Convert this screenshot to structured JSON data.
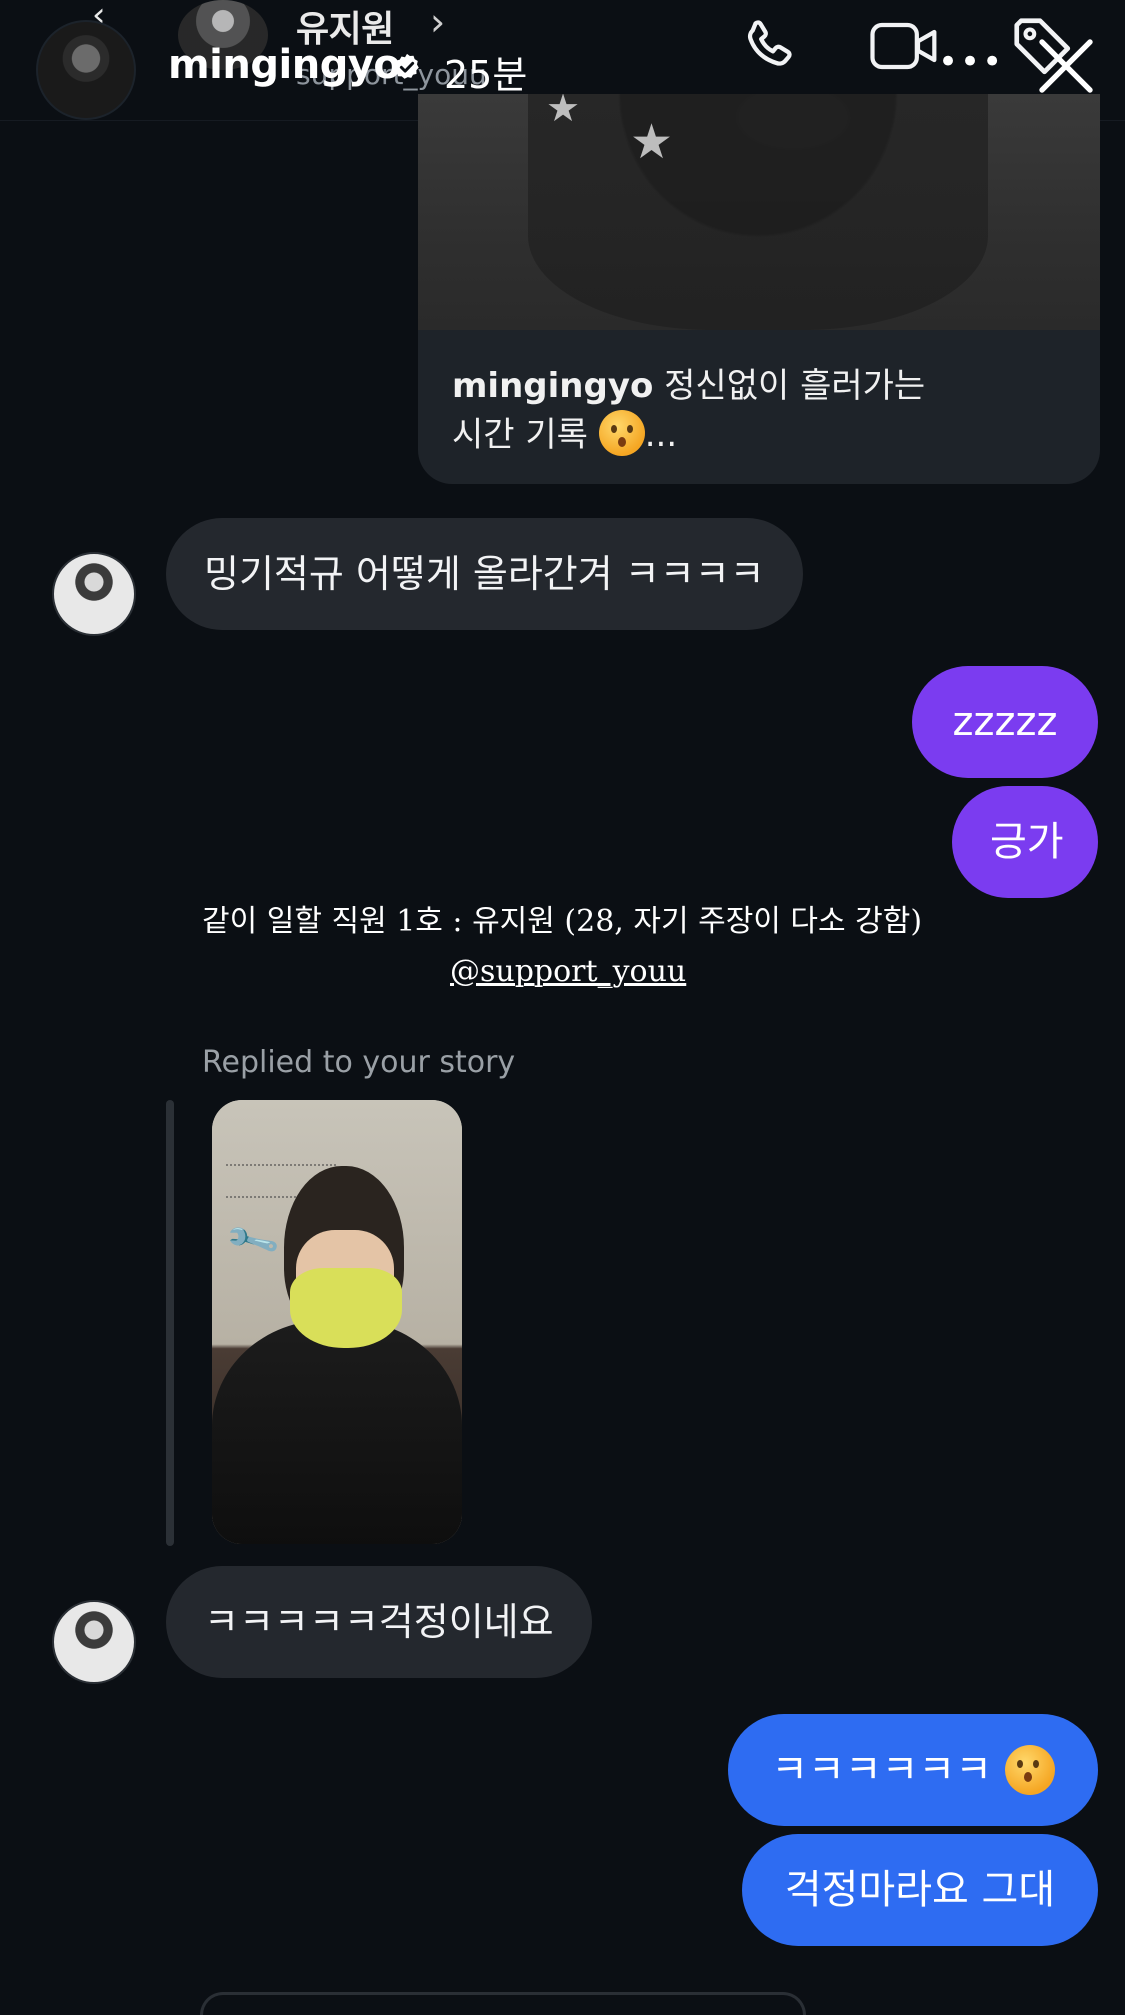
{
  "header": {
    "thread_name": "유지원",
    "thread_handle": "support_youu",
    "story_username": "mingingyo",
    "story_time": "25분"
  },
  "post_card": {
    "username": "mingingyo",
    "caption_line1": "정신없이 흘러가는",
    "caption_line2": "시간 기록",
    "caption_suffix": "..."
  },
  "messages": {
    "m1": "밍기적규 어떻게 올라간겨 ㅋㅋㅋㅋ",
    "m2": "zzzzz",
    "m3": "긍가",
    "story_caption": "같이 일할 직원 1호 : 유지원 (28, 자기 주장이 다소 강함)",
    "story_mention": "@support_youu",
    "replied_label": "Replied to your story",
    "m4": "ㅋㅋㅋㅋㅋ걱정이네요",
    "m5": "ㅋㅋㅋㅋㅋㅋ",
    "m6": "걱정마라요 그대"
  },
  "colors": {
    "background": "#0b0f14",
    "incoming_bubble": "#24282e",
    "outgoing_purple": "#7b3cf0",
    "outgoing_blue": "#2e6cf2"
  }
}
